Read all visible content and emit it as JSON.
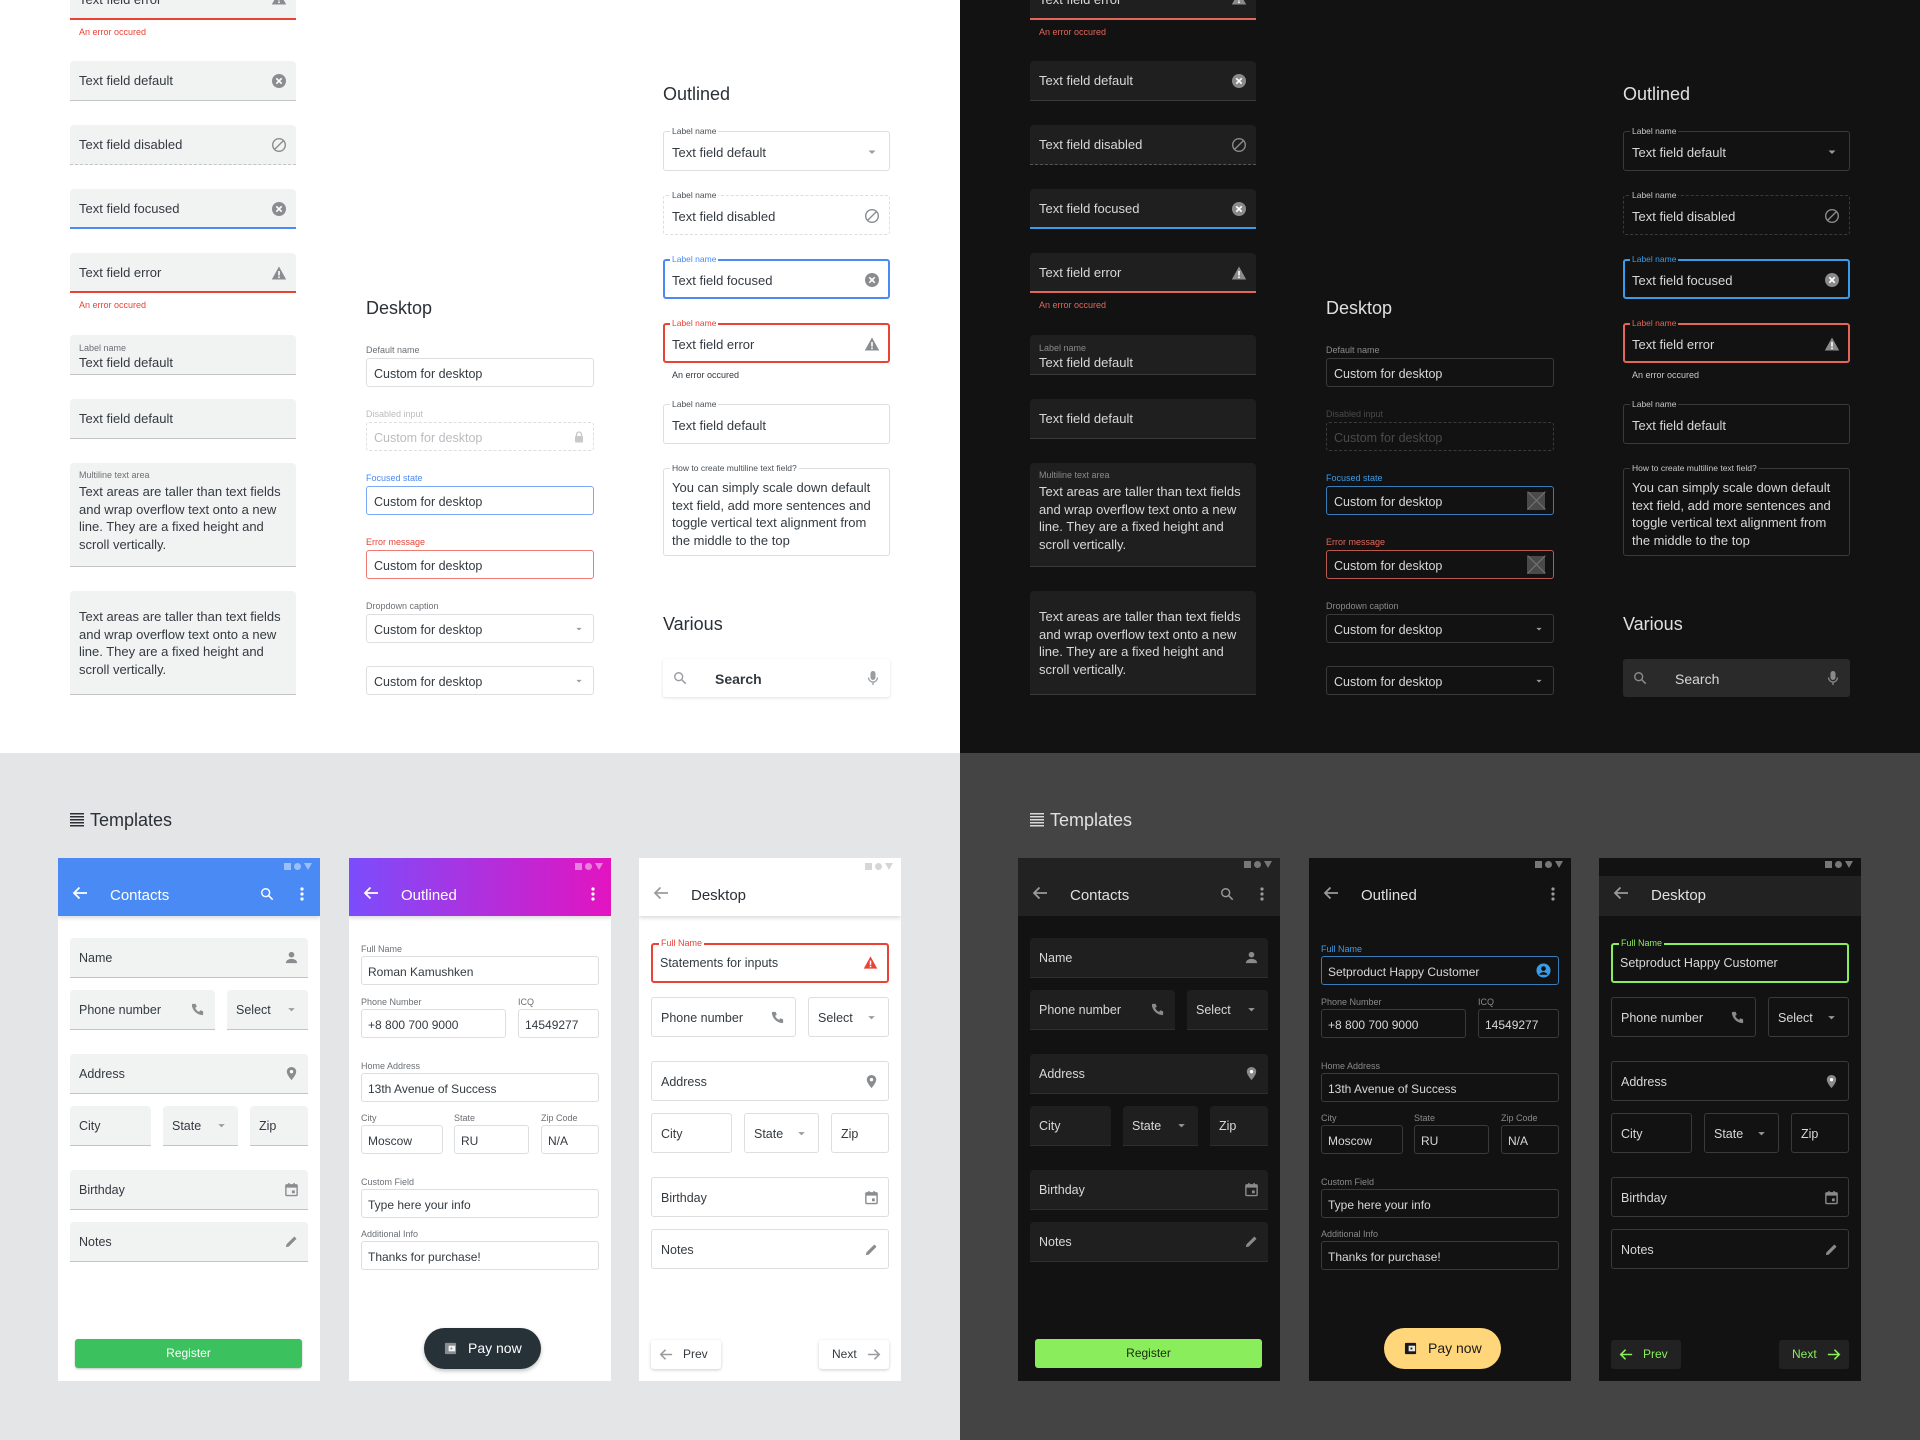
{
  "colors": {
    "primary_blue": "#4a8af4",
    "error_red": "#ea4335",
    "success_green": "#3bc15d",
    "dark_green": "#8aee5c",
    "dark_focus_blue": "#3a9ce8",
    "pay_yellow": "#ffd77a",
    "gradient_start": "#7b4dfc",
    "gradient_end": "#e214c0"
  },
  "filled": {
    "top_error": "Text field error",
    "top_error_msg": "An error occured",
    "default_clear": "Text field default",
    "disabled": "Text field disabled",
    "focused": "Text field focused",
    "error": "Text field error",
    "error_msg": "An error occured",
    "labeled_label": "Label name",
    "labeled_value": "Text field default",
    "plain": "Text field default",
    "textarea_label": "Multiline text area",
    "textarea_text": "Text areas are taller than text fields and wrap overflow text onto a new line. They are a fixed height and scroll vertically.",
    "textarea2_text": "Text areas are taller than text fields and wrap overflow text onto a new line. They are a fixed height and scroll vertically."
  },
  "desktop": {
    "heading": "Desktop",
    "fields": [
      {
        "label": "Default name",
        "value": "Custom for desktop"
      },
      {
        "label": "Disabled input",
        "value": "Custom for desktop"
      },
      {
        "label": "Focused state",
        "value": "Custom for desktop"
      },
      {
        "label": "Error message",
        "value": "Custom for desktop"
      },
      {
        "label": "Dropdown caption",
        "value": "Custom for desktop"
      },
      {
        "label": "",
        "value": "Custom for desktop"
      }
    ]
  },
  "outlined": {
    "heading": "Outlined",
    "fields": [
      {
        "label": "Label name",
        "value": "Text field default"
      },
      {
        "label": "Label name",
        "value": "Text field disabled"
      },
      {
        "label": "Label name",
        "value": "Text field focused"
      },
      {
        "label": "Label name",
        "value": "Text field error"
      },
      {
        "label": "Label name",
        "value": "Text field default"
      }
    ],
    "error_msg": "An error occured",
    "multiline_label": "How to create multiline text field?",
    "multiline_text": "You can simply scale down default text field, add more sentences and toggle vertical text alignment from the middle to the top"
  },
  "various": {
    "heading": "Various",
    "search_placeholder": "Search"
  },
  "templates": {
    "heading": "Templates",
    "contacts": {
      "title": "Contacts",
      "fields": {
        "name": "Name",
        "phone": "Phone number",
        "select": "Select",
        "address": "Address",
        "city": "City",
        "state": "State",
        "zip": "Zip",
        "birthday": "Birthday",
        "notes": "Notes"
      },
      "register": "Register"
    },
    "outlined": {
      "title": "Outlined",
      "full_name_label": "Full Name",
      "full_name_light": "Roman Kamushken",
      "full_name_dark": "Setproduct Happy Customer",
      "phone_label": "Phone Number",
      "phone": "+8 800 700 9000",
      "icq_label": "ICQ",
      "icq": "14549277",
      "address_label": "Home Address",
      "address": "13th Avenue of Success",
      "city_label": "City",
      "city": "Moscow",
      "state_label": "State",
      "state": "RU",
      "zip_label": "Zip Code",
      "zip": "N/A",
      "custom_label": "Custom Field",
      "custom": "Type here your info",
      "additional_label": "Additional Info",
      "additional": "Thanks for purchase!",
      "pay": "Pay now"
    },
    "desktop": {
      "title": "Desktop",
      "full_name_label": "Full Name",
      "full_name_light": "Statements for inputs",
      "full_name_dark": "Setproduct Happy Customer",
      "prev": "Prev",
      "next": "Next"
    }
  }
}
